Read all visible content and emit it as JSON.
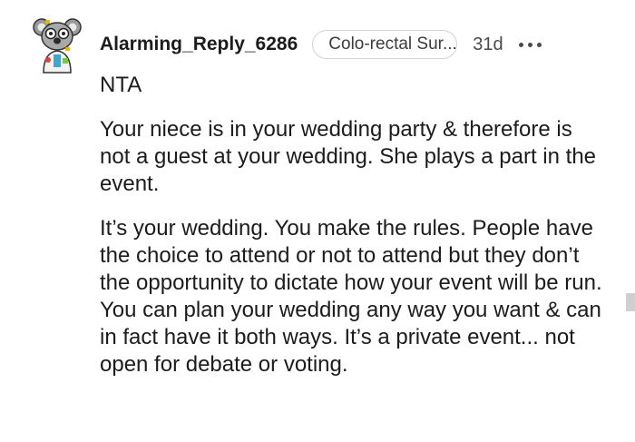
{
  "comment": {
    "username": "Alarming_Reply_6286",
    "flair": "Colo-rectal Sur...",
    "age": "31d",
    "more_icon": "more-horizontal-icon",
    "avatar_icon": "koala-avatar-icon",
    "paragraphs": [
      "NTA",
      "Your niece is in your wedding party & therefore is not a guest at your wedding. She plays a part in the event.",
      "It’s your wedding. You make the rules. People have the choice to attend or not to attend but they don’t the opportunity to dictate how your event will be run. You can plan your wedding any way you want & can in fact have it both ways. It’s a private event... not open for debate or voting."
    ]
  },
  "colors": {
    "text": "#1c1c1c",
    "muted": "#4a4a4a",
    "flair_border": "#d4d4d4",
    "background": "#ffffff"
  }
}
